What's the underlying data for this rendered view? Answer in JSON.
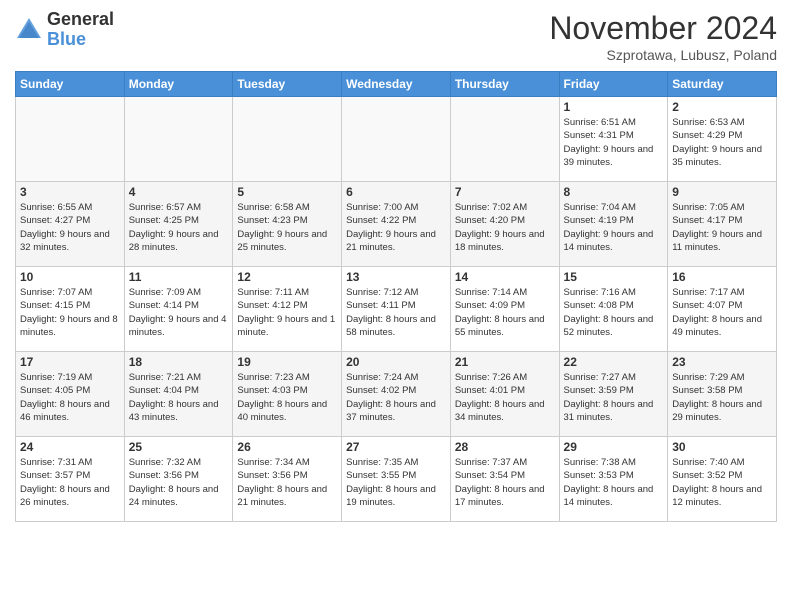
{
  "header": {
    "logo_line1": "General",
    "logo_line2": "Blue",
    "month": "November 2024",
    "location": "Szprotawa, Lubusz, Poland"
  },
  "days_of_week": [
    "Sunday",
    "Monday",
    "Tuesday",
    "Wednesday",
    "Thursday",
    "Friday",
    "Saturday"
  ],
  "weeks": [
    [
      {
        "day": "",
        "info": ""
      },
      {
        "day": "",
        "info": ""
      },
      {
        "day": "",
        "info": ""
      },
      {
        "day": "",
        "info": ""
      },
      {
        "day": "",
        "info": ""
      },
      {
        "day": "1",
        "info": "Sunrise: 6:51 AM\nSunset: 4:31 PM\nDaylight: 9 hours\nand 39 minutes."
      },
      {
        "day": "2",
        "info": "Sunrise: 6:53 AM\nSunset: 4:29 PM\nDaylight: 9 hours\nand 35 minutes."
      }
    ],
    [
      {
        "day": "3",
        "info": "Sunrise: 6:55 AM\nSunset: 4:27 PM\nDaylight: 9 hours\nand 32 minutes."
      },
      {
        "day": "4",
        "info": "Sunrise: 6:57 AM\nSunset: 4:25 PM\nDaylight: 9 hours\nand 28 minutes."
      },
      {
        "day": "5",
        "info": "Sunrise: 6:58 AM\nSunset: 4:23 PM\nDaylight: 9 hours\nand 25 minutes."
      },
      {
        "day": "6",
        "info": "Sunrise: 7:00 AM\nSunset: 4:22 PM\nDaylight: 9 hours\nand 21 minutes."
      },
      {
        "day": "7",
        "info": "Sunrise: 7:02 AM\nSunset: 4:20 PM\nDaylight: 9 hours\nand 18 minutes."
      },
      {
        "day": "8",
        "info": "Sunrise: 7:04 AM\nSunset: 4:19 PM\nDaylight: 9 hours\nand 14 minutes."
      },
      {
        "day": "9",
        "info": "Sunrise: 7:05 AM\nSunset: 4:17 PM\nDaylight: 9 hours\nand 11 minutes."
      }
    ],
    [
      {
        "day": "10",
        "info": "Sunrise: 7:07 AM\nSunset: 4:15 PM\nDaylight: 9 hours\nand 8 minutes."
      },
      {
        "day": "11",
        "info": "Sunrise: 7:09 AM\nSunset: 4:14 PM\nDaylight: 9 hours\nand 4 minutes."
      },
      {
        "day": "12",
        "info": "Sunrise: 7:11 AM\nSunset: 4:12 PM\nDaylight: 9 hours\nand 1 minute."
      },
      {
        "day": "13",
        "info": "Sunrise: 7:12 AM\nSunset: 4:11 PM\nDaylight: 8 hours\nand 58 minutes."
      },
      {
        "day": "14",
        "info": "Sunrise: 7:14 AM\nSunset: 4:09 PM\nDaylight: 8 hours\nand 55 minutes."
      },
      {
        "day": "15",
        "info": "Sunrise: 7:16 AM\nSunset: 4:08 PM\nDaylight: 8 hours\nand 52 minutes."
      },
      {
        "day": "16",
        "info": "Sunrise: 7:17 AM\nSunset: 4:07 PM\nDaylight: 8 hours\nand 49 minutes."
      }
    ],
    [
      {
        "day": "17",
        "info": "Sunrise: 7:19 AM\nSunset: 4:05 PM\nDaylight: 8 hours\nand 46 minutes."
      },
      {
        "day": "18",
        "info": "Sunrise: 7:21 AM\nSunset: 4:04 PM\nDaylight: 8 hours\nand 43 minutes."
      },
      {
        "day": "19",
        "info": "Sunrise: 7:23 AM\nSunset: 4:03 PM\nDaylight: 8 hours\nand 40 minutes."
      },
      {
        "day": "20",
        "info": "Sunrise: 7:24 AM\nSunset: 4:02 PM\nDaylight: 8 hours\nand 37 minutes."
      },
      {
        "day": "21",
        "info": "Sunrise: 7:26 AM\nSunset: 4:01 PM\nDaylight: 8 hours\nand 34 minutes."
      },
      {
        "day": "22",
        "info": "Sunrise: 7:27 AM\nSunset: 3:59 PM\nDaylight: 8 hours\nand 31 minutes."
      },
      {
        "day": "23",
        "info": "Sunrise: 7:29 AM\nSunset: 3:58 PM\nDaylight: 8 hours\nand 29 minutes."
      }
    ],
    [
      {
        "day": "24",
        "info": "Sunrise: 7:31 AM\nSunset: 3:57 PM\nDaylight: 8 hours\nand 26 minutes."
      },
      {
        "day": "25",
        "info": "Sunrise: 7:32 AM\nSunset: 3:56 PM\nDaylight: 8 hours\nand 24 minutes."
      },
      {
        "day": "26",
        "info": "Sunrise: 7:34 AM\nSunset: 3:56 PM\nDaylight: 8 hours\nand 21 minutes."
      },
      {
        "day": "27",
        "info": "Sunrise: 7:35 AM\nSunset: 3:55 PM\nDaylight: 8 hours\nand 19 minutes."
      },
      {
        "day": "28",
        "info": "Sunrise: 7:37 AM\nSunset: 3:54 PM\nDaylight: 8 hours\nand 17 minutes."
      },
      {
        "day": "29",
        "info": "Sunrise: 7:38 AM\nSunset: 3:53 PM\nDaylight: 8 hours\nand 14 minutes."
      },
      {
        "day": "30",
        "info": "Sunrise: 7:40 AM\nSunset: 3:52 PM\nDaylight: 8 hours\nand 12 minutes."
      }
    ]
  ]
}
